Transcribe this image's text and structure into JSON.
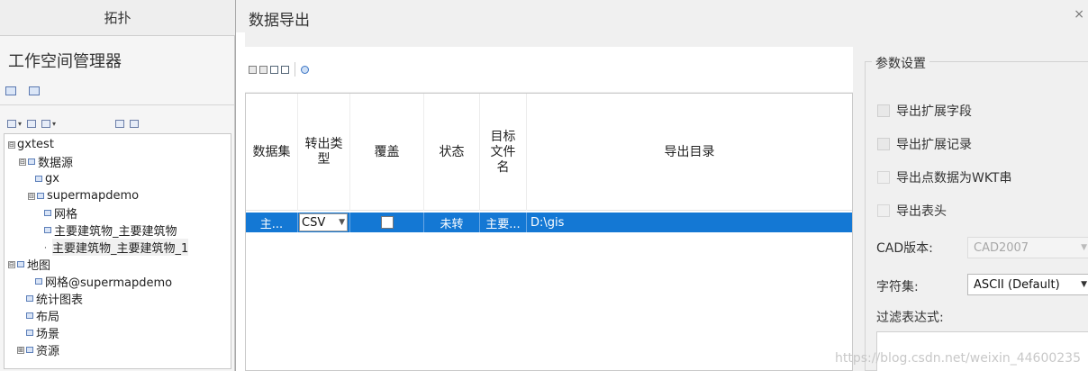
{
  "left_panel": {
    "tab_title": "拓扑",
    "workspace_title": "工作空间管理器",
    "tree": [
      {
        "label": "gxtest",
        "level": 0,
        "expander": "⊟"
      },
      {
        "label": "数据源",
        "level": 1,
        "expander": "⊟"
      },
      {
        "label": "gx",
        "level": 2,
        "expander": ""
      },
      {
        "label": "supermapdemo",
        "level": 1,
        "expander": "⊟"
      },
      {
        "label": "网格",
        "level": 2,
        "expander": ""
      },
      {
        "label": "主要建筑物_主要建筑物",
        "level": 2,
        "expander": ""
      },
      {
        "label": "主要建筑物_主要建筑物_1",
        "level": 2,
        "expander": ""
      },
      {
        "label": "地图",
        "level": 0,
        "expander": "⊟"
      },
      {
        "label": "网格@supermapdemo",
        "level": 1,
        "expander": ""
      },
      {
        "label": "统计图表",
        "level": 0,
        "expander": ""
      },
      {
        "label": "布局",
        "level": 0,
        "expander": ""
      },
      {
        "label": "场景",
        "level": 0,
        "expander": ""
      },
      {
        "label": "资源",
        "level": 0,
        "expander": "⊞"
      }
    ]
  },
  "dialog": {
    "title": "数据导出",
    "close": "×",
    "grid": {
      "headers": [
        "数据集",
        "转出类型",
        "覆盖",
        "状态",
        "目标文件名",
        "导出目录"
      ],
      "headers_display": [
        "数据集",
        "转出类\n型",
        "覆盖",
        "状态",
        "目标\n文件\n名",
        "导出目录"
      ],
      "rows": [
        {
          "dataset": "主...",
          "type": "CSV",
          "overwrite": false,
          "status": "未转",
          "target_file": "主要...",
          "directory": "D:\\gis"
        }
      ]
    },
    "params": {
      "legend": "参数设置",
      "export_ext_fields": "导出扩展字段",
      "export_ext_records": "导出扩展记录",
      "export_point_wkt": "导出点数据为WKT串",
      "export_header": "导出表头",
      "cad_version_label": "CAD版本:",
      "cad_version_value": "CAD2007",
      "charset_label": "字符集:",
      "charset_value": "ASCII (Default)",
      "filter_label": "过滤表达式:"
    }
  },
  "watermark": "https://blog.csdn.net/weixin_44600235"
}
